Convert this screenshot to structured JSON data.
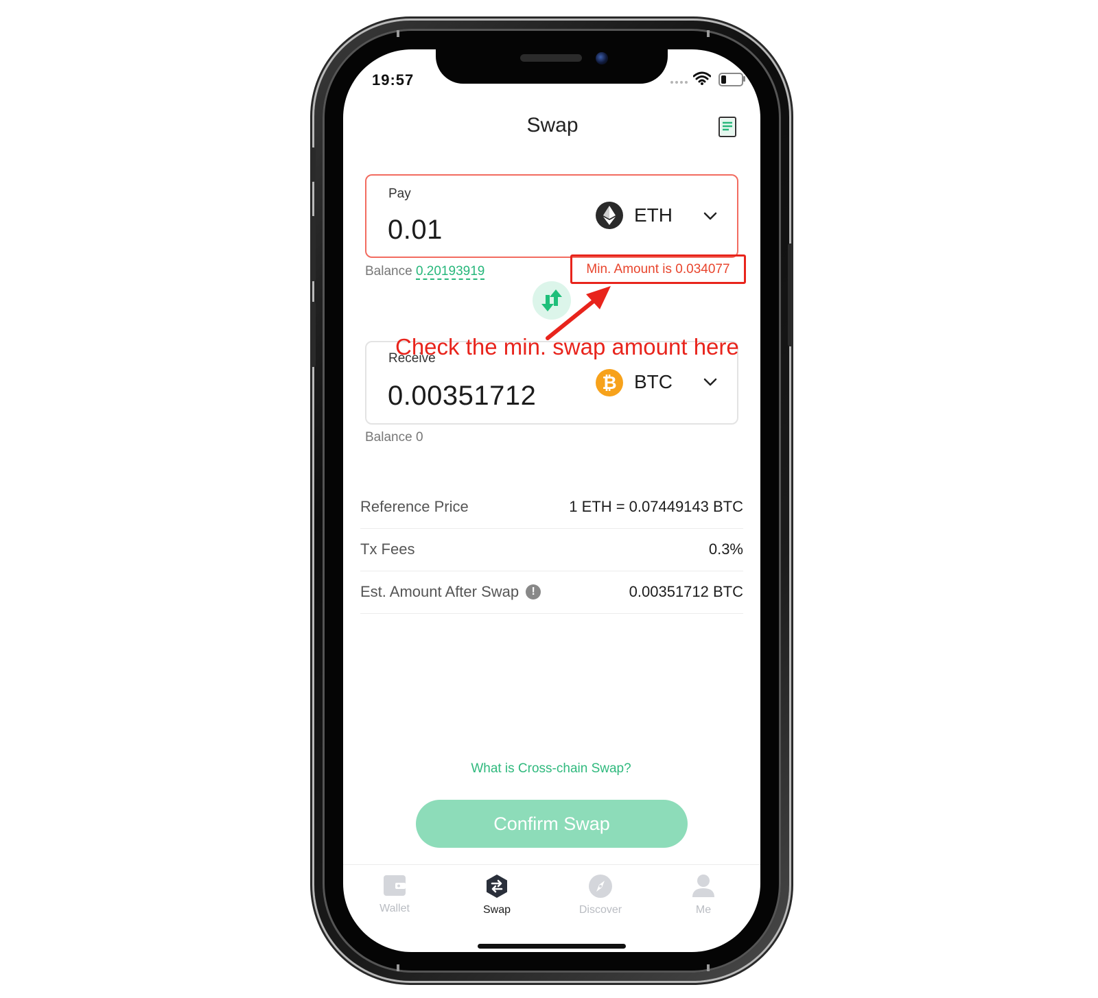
{
  "status_bar": {
    "time": "19:57"
  },
  "header": {
    "title": "Swap",
    "history_icon": "document-list-icon"
  },
  "pay": {
    "label": "Pay",
    "amount": "0.01",
    "token": "ETH",
    "balance_label": "Balance",
    "balance_value": "0.20193919",
    "min_amount": "Min. Amount is 0.034077"
  },
  "receive": {
    "label": "Receive",
    "amount": "0.00351712",
    "token": "BTC",
    "balance": "Balance 0"
  },
  "annotation": "Check the min. swap amount here",
  "details": [
    {
      "label": "Reference Price",
      "value": "1 ETH = 0.07449143 BTC"
    },
    {
      "label": "Tx Fees",
      "value": "0.3%"
    },
    {
      "label": "Est. Amount After Swap",
      "value": "0.00351712 BTC"
    }
  ],
  "help_link": "What is Cross-chain Swap?",
  "confirm_button": "Confirm Swap",
  "tabs": [
    {
      "label": "Wallet",
      "icon": "wallet-icon",
      "active": false
    },
    {
      "label": "Swap",
      "icon": "swap-icon",
      "active": true
    },
    {
      "label": "Discover",
      "icon": "compass-icon",
      "active": false
    },
    {
      "label": "Me",
      "icon": "user-icon",
      "active": false
    }
  ],
  "colors": {
    "accent_green": "#27b77b",
    "confirm_button": "#8ddcb9",
    "error_red": "#e8241c",
    "pay_border": "#f26b5f",
    "btc_orange": "#f7a21b"
  }
}
